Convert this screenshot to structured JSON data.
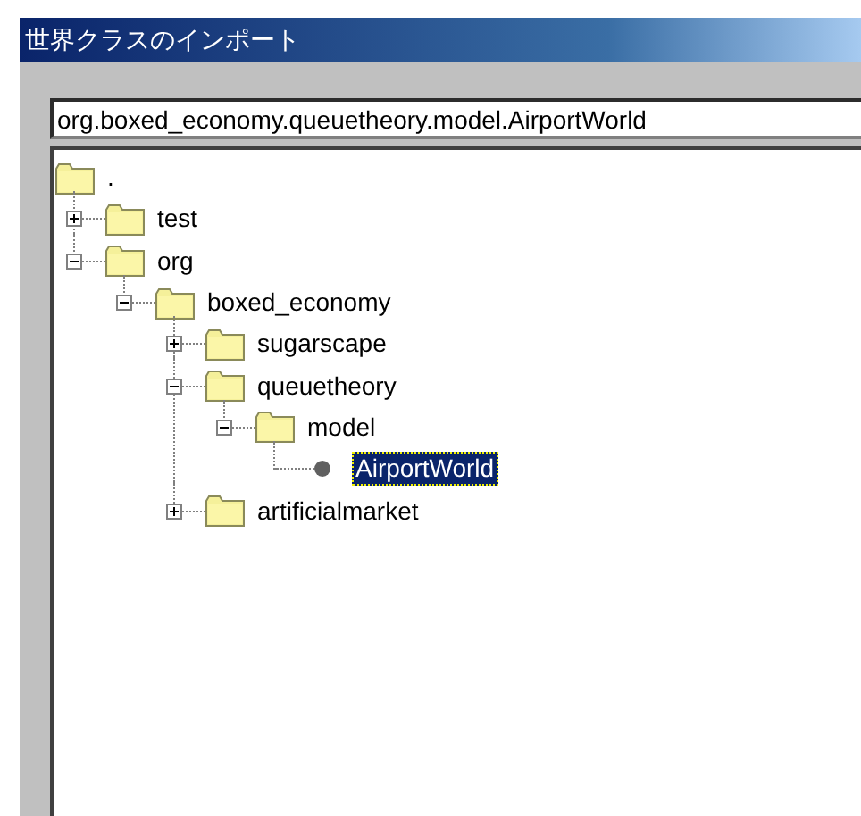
{
  "window": {
    "title": "世界クラスのインポート"
  },
  "class_field": {
    "value": "org.boxed_economy.queuetheory.model.AirportWorld"
  },
  "tree": [
    {
      "label": ".",
      "kind": "folder",
      "selected": false,
      "children": [
        {
          "label": "test",
          "kind": "folder",
          "expanded": false,
          "selected": false
        },
        {
          "label": "org",
          "kind": "folder",
          "expanded": true,
          "selected": false,
          "children": [
            {
              "label": "boxed_economy",
              "kind": "folder",
              "expanded": true,
              "selected": false,
              "children": [
                {
                  "label": "sugarscape",
                  "kind": "folder",
                  "expanded": false,
                  "selected": false
                },
                {
                  "label": "queuetheory",
                  "kind": "folder",
                  "expanded": true,
                  "selected": false,
                  "children": [
                    {
                      "label": "model",
                      "kind": "folder",
                      "expanded": true,
                      "selected": false,
                      "children": [
                        {
                          "label": "AirportWorld",
                          "kind": "class",
                          "selected": true
                        }
                      ]
                    }
                  ]
                },
                {
                  "label": "artificialmarket",
                  "kind": "folder",
                  "expanded": false,
                  "selected": false
                }
              ]
            }
          ]
        }
      ]
    }
  ]
}
